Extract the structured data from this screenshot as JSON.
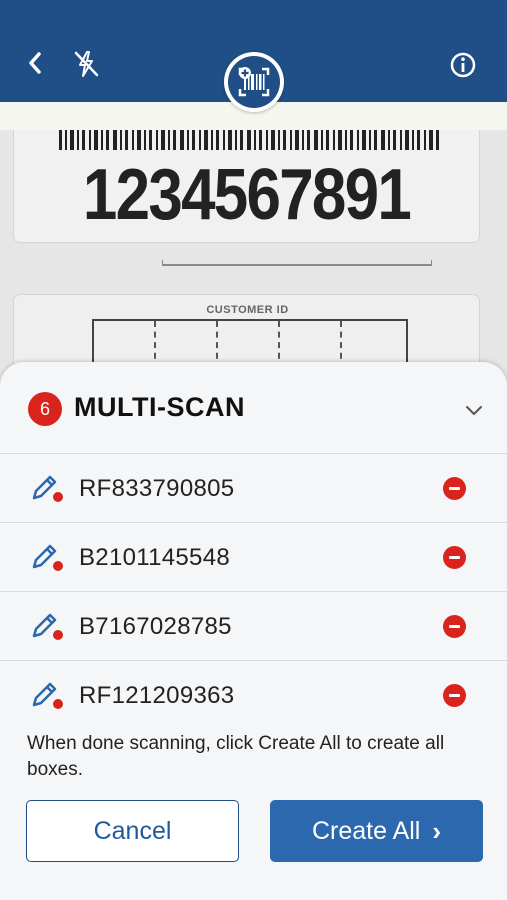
{
  "header": {
    "back_icon": "chevron-left-icon",
    "flash_icon": "flash-off-icon",
    "scan_icon": "barcode-scan-icon",
    "info_icon": "info-icon",
    "color": "#1f4f86"
  },
  "camera": {
    "label_number": "1234567891",
    "customer_id_label": "CUSTOMER ID"
  },
  "multiscan": {
    "count": "6",
    "title": "MULTI-SCAN",
    "collapse_icon": "chevron-down-icon",
    "items": [
      {
        "code": "RF833790805",
        "edit_icon": "pencil-icon",
        "remove_icon": "remove-icon"
      },
      {
        "code": "B2101145548",
        "edit_icon": "pencil-icon",
        "remove_icon": "remove-icon"
      },
      {
        "code": "B7167028785",
        "edit_icon": "pencil-icon",
        "remove_icon": "remove-icon"
      },
      {
        "code": "RF121209363",
        "edit_icon": "pencil-icon",
        "remove_icon": "remove-icon"
      }
    ],
    "hint": "When done scanning, click Create All to create all boxes.",
    "cancel_label": "Cancel",
    "create_label": "Create All",
    "create_arrow": "›",
    "accent_color": "#2b68ad",
    "badge_color": "#d9241d"
  }
}
